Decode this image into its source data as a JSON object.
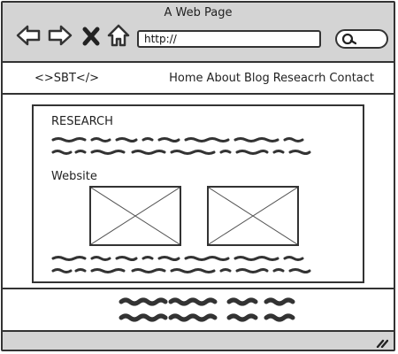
{
  "window": {
    "title": "A Web Page"
  },
  "browser": {
    "url": "http://",
    "icons": [
      "back-arrow-icon",
      "forward-arrow-icon",
      "close-x-icon",
      "home-icon",
      "search-icon"
    ]
  },
  "site": {
    "logo": "<>SBT</>",
    "nav": [
      "Home",
      "About",
      "Blog",
      "Reseacrh",
      "Contact"
    ]
  },
  "content": {
    "section_title": "RESEARCH",
    "website_label": "Website"
  },
  "colors": {
    "chrome": "#d4d4d4",
    "ink": "#333333",
    "paper": "#ffffff"
  }
}
